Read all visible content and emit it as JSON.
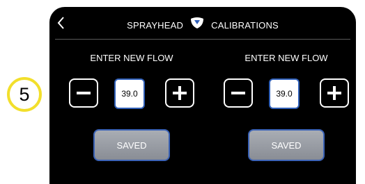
{
  "callout": {
    "number": "5"
  },
  "header": {
    "title_left": "SPRAYHEAD",
    "title_right": "CALIBRATIONS",
    "back_icon": "chevron-left-icon",
    "logo_icon": "drop-logo-icon"
  },
  "panels": [
    {
      "label": "ENTER NEW FLOW",
      "value": "39.0",
      "save_label": "SAVED"
    },
    {
      "label": "ENTER NEW FLOW",
      "value": "39.0",
      "save_label": "SAVED"
    }
  ],
  "colors": {
    "callout_ring": "#f2df2c",
    "screen_bg": "#000000",
    "accent_border": "#3a62b6",
    "save_button": "#989ca3"
  }
}
